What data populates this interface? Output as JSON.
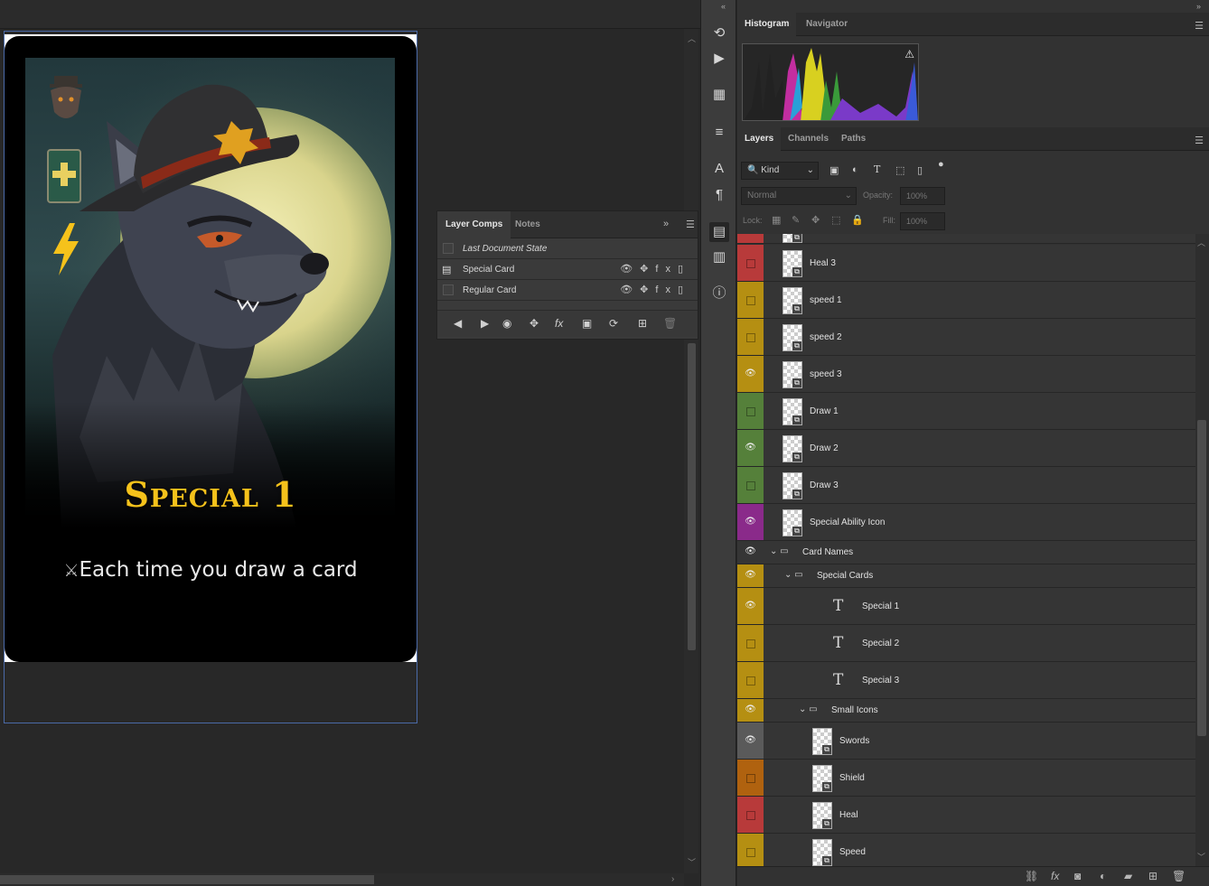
{
  "card": {
    "title": "Special 1",
    "text": "Each time you draw a card",
    "title_color": "#f5c21b"
  },
  "layer_comps": {
    "tabs": [
      "Layer Comps",
      "Notes"
    ],
    "rows": [
      {
        "label": "Last Document State"
      },
      {
        "label": "Special Card"
      },
      {
        "label": "Regular Card"
      }
    ]
  },
  "histogram_panel": {
    "tabs": [
      "Histogram",
      "Navigator"
    ]
  },
  "layers_panel": {
    "tabs": [
      "Layers",
      "Channels",
      "Paths"
    ],
    "filter_kind": "Kind",
    "blend_mode": "Normal",
    "opacity_label": "Opacity:",
    "opacity_value": "100%",
    "lock_label": "Lock:",
    "fill_label": "Fill:",
    "fill_value": "100%",
    "layers": [
      {
        "name": "Heal 3",
        "color": "#b83a3a",
        "visible": false,
        "kind": "smart"
      },
      {
        "name": "speed 1",
        "color": "#b58f12",
        "visible": false,
        "kind": "smart"
      },
      {
        "name": "speed 2",
        "color": "#b58f12",
        "visible": false,
        "kind": "smart"
      },
      {
        "name": "speed 3",
        "color": "#b58f12",
        "visible": true,
        "kind": "smart"
      },
      {
        "name": "Draw 1",
        "color": "#55803a",
        "visible": false,
        "kind": "smart"
      },
      {
        "name": "Draw 2",
        "color": "#55803a",
        "visible": true,
        "kind": "smart"
      },
      {
        "name": "Draw 3",
        "color": "#55803a",
        "visible": false,
        "kind": "smart"
      },
      {
        "name": "Special Ability Icon",
        "color": "#8a2a8a",
        "visible": true,
        "kind": "smart"
      },
      {
        "name": "Card Names",
        "color": "#353535",
        "visible": true,
        "kind": "group"
      },
      {
        "name": "Special Cards",
        "color": "#b58f12",
        "visible": true,
        "kind": "group"
      },
      {
        "name": "Special 1",
        "color": "#b58f12",
        "visible": true,
        "kind": "text"
      },
      {
        "name": "Special 2",
        "color": "#b58f12",
        "visible": false,
        "kind": "text"
      },
      {
        "name": "Special 3",
        "color": "#b58f12",
        "visible": false,
        "kind": "text"
      },
      {
        "name": "Small Icons",
        "color": "#b58f12",
        "visible": true,
        "kind": "group"
      },
      {
        "name": "Swords",
        "color": "#5a5a5a",
        "visible": true,
        "kind": "smart"
      },
      {
        "name": "Shield",
        "color": "#b0620f",
        "visible": false,
        "kind": "smart"
      },
      {
        "name": "Heal",
        "color": "#b83a3a",
        "visible": false,
        "kind": "smart"
      },
      {
        "name": "Speed",
        "color": "#b58f12",
        "visible": false,
        "kind": "smart"
      }
    ]
  }
}
